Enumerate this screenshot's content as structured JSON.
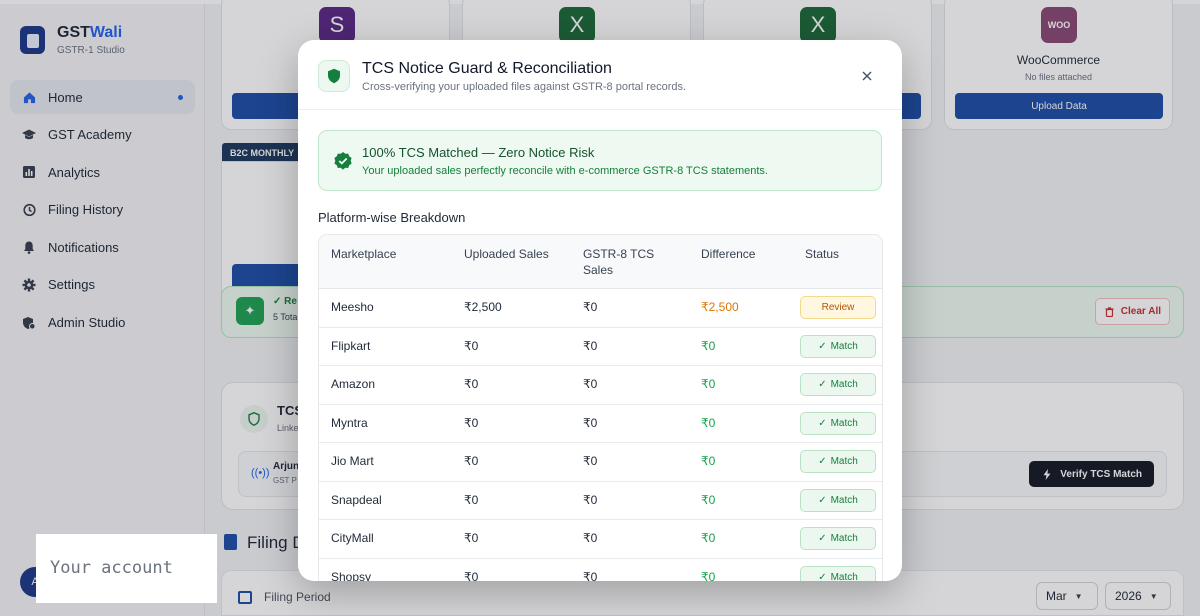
{
  "sidebar": {
    "brand_prefix": "GST",
    "brand_accent": "Wali",
    "brand_sub": "GSTR-1 Studio",
    "items": [
      {
        "label": "Home",
        "icon": "home-icon"
      },
      {
        "label": "GST Academy",
        "icon": "graduation-cap-icon"
      },
      {
        "label": "Analytics",
        "icon": "bar-chart-icon"
      },
      {
        "label": "Filing History",
        "icon": "history-icon"
      },
      {
        "label": "Notifications",
        "icon": "bell-icon"
      },
      {
        "label": "Settings",
        "icon": "gear-icon"
      },
      {
        "label": "Admin Studio",
        "icon": "admin-icon"
      }
    ],
    "account_initial": "A"
  },
  "background": {
    "marketplace_icons": [
      "S",
      "X",
      "X"
    ],
    "woo": {
      "logo": "WOO",
      "title": "WooCommerce",
      "status": "No files attached",
      "button": "Upload Data"
    },
    "b2c_tag": "B2C MONTHLY",
    "ready_text": "✓ Re",
    "ready_sub": "5 Tota",
    "clear_all": "Clear All",
    "tcs_title": "TCS",
    "tcs_sub": "Linke",
    "seller_name": "Arjun",
    "seller_sub": "GST P",
    "verify_button": "Verify TCS Match",
    "filing_title": "Filing D",
    "filing_period_label": "Filing Period",
    "month": "Mar",
    "year": "2026"
  },
  "account_tooltip": "Your account",
  "modal": {
    "title": "TCS Notice Guard & Reconciliation",
    "subtitle": "Cross-verifying your uploaded files against GSTR-8 portal records.",
    "banner_title": "100% TCS Matched — Zero Notice Risk",
    "banner_sub": "Your uploaded sales perfectly reconcile with e-commerce GSTR-8 TCS statements.",
    "breakdown_title": "Platform-wise Breakdown",
    "columns": [
      "Marketplace",
      "Uploaded Sales",
      "GSTR-8 TCS Sales",
      "Difference",
      "Status"
    ],
    "rows": [
      {
        "marketplace": "Meesho",
        "uploaded": "₹2,500",
        "gstr8": "₹0",
        "difference": "₹2,500",
        "status": "Review"
      },
      {
        "marketplace": "Flipkart",
        "uploaded": "₹0",
        "gstr8": "₹0",
        "difference": "₹0",
        "status": "Match"
      },
      {
        "marketplace": "Amazon",
        "uploaded": "₹0",
        "gstr8": "₹0",
        "difference": "₹0",
        "status": "Match"
      },
      {
        "marketplace": "Myntra",
        "uploaded": "₹0",
        "gstr8": "₹0",
        "difference": "₹0",
        "status": "Match"
      },
      {
        "marketplace": "Jio Mart",
        "uploaded": "₹0",
        "gstr8": "₹0",
        "difference": "₹0",
        "status": "Match"
      },
      {
        "marketplace": "Snapdeal",
        "uploaded": "₹0",
        "gstr8": "₹0",
        "difference": "₹0",
        "status": "Match"
      },
      {
        "marketplace": "CityMall",
        "uploaded": "₹0",
        "gstr8": "₹0",
        "difference": "₹0",
        "status": "Match"
      },
      {
        "marketplace": "Shopsy",
        "uploaded": "₹0",
        "gstr8": "₹0",
        "difference": "₹0",
        "status": "Match"
      }
    ]
  },
  "colors": {
    "accent_blue": "#1e4fa8",
    "match_green": "#16a34a",
    "review_amber": "#d97706",
    "overlay": "rgba(20,24,32,0.18)"
  }
}
